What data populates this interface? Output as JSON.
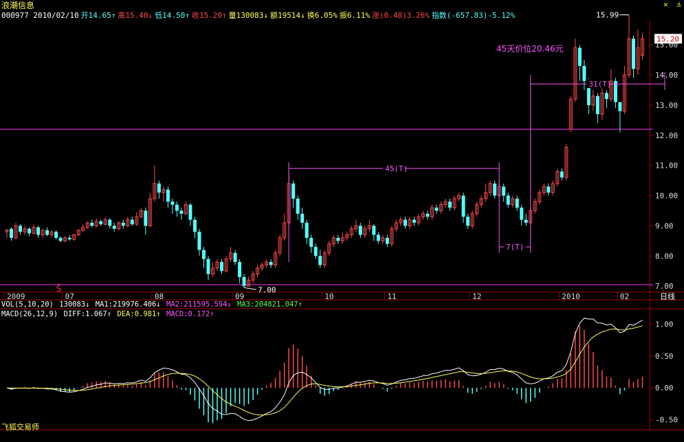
{
  "header": {
    "title": "浪潮信息",
    "quote": [
      {
        "text": "000977 2010/02/10",
        "color": "#ffffff"
      },
      {
        "text": "开14.65↑",
        "color": "#55ffff"
      },
      {
        "text": "高15.40↓",
        "color": "#ff4a4a"
      },
      {
        "text": "低14.50↑",
        "color": "#55ffff"
      },
      {
        "text": "收15.20↑",
        "color": "#ff4a4a"
      },
      {
        "text": "量130083↓",
        "color": "#ffff55"
      },
      {
        "text": "额19514↓",
        "color": "#ffff55"
      },
      {
        "text": "换6.05%",
        "color": "#ffff55"
      },
      {
        "text": "振6.11%",
        "color": "#ffff55"
      },
      {
        "text": "涨(0.48)3.26%",
        "color": "#ff4a4a"
      },
      {
        "text": "指数(-657.83)-5.12%",
        "color": "#55ffff"
      }
    ],
    "icons": [
      "close-icon",
      "anchor-icon"
    ]
  },
  "chart_data": {
    "type": "candlestick",
    "period_label": "日线",
    "ylim": [
      6.8,
      15.8
    ],
    "price_ticks": [
      "7.00",
      "8.00",
      "9.00",
      "10.00",
      "11.00",
      "12.00",
      "13.00",
      "14.00",
      "15.00"
    ],
    "current_price": "15.20",
    "x_labels": [
      {
        "text": "2009",
        "i": 0
      },
      {
        "text": "07",
        "i": 13
      },
      {
        "text": "08",
        "i": 33
      },
      {
        "text": "09",
        "i": 51
      },
      {
        "text": "10",
        "i": 71
      },
      {
        "text": "11",
        "i": 85
      },
      {
        "text": "12",
        "i": 104
      },
      {
        "text": "2010",
        "i": 124
      },
      {
        "text": "02",
        "i": 137
      }
    ],
    "candles": [
      [
        8.8,
        8.85,
        8.6,
        8.9
      ],
      [
        8.9,
        8.6,
        8.5,
        8.95
      ],
      [
        8.6,
        9.0,
        8.55,
        9.1
      ],
      [
        9.0,
        8.8,
        8.7,
        9.05
      ],
      [
        8.8,
        8.9,
        8.7,
        9.0
      ],
      [
        8.9,
        8.75,
        8.65,
        8.95
      ],
      [
        8.75,
        8.95,
        8.7,
        9.05
      ],
      [
        8.95,
        8.7,
        8.6,
        9.0
      ],
      [
        8.7,
        8.85,
        8.6,
        8.9
      ],
      [
        8.85,
        8.7,
        8.65,
        8.95
      ],
      [
        8.7,
        8.8,
        8.6,
        8.85
      ],
      [
        8.8,
        8.6,
        8.55,
        8.85
      ],
      [
        8.6,
        8.5,
        8.45,
        8.65
      ],
      [
        8.5,
        8.6,
        8.45,
        8.65
      ],
      [
        8.6,
        8.55,
        8.5,
        8.7
      ],
      [
        8.55,
        8.7,
        8.5,
        8.75
      ],
      [
        8.7,
        8.85,
        8.65,
        8.9
      ],
      [
        8.85,
        8.95,
        8.8,
        9.05
      ],
      [
        8.95,
        9.1,
        8.9,
        9.15
      ],
      [
        9.1,
        9.0,
        8.95,
        9.2
      ],
      [
        9.0,
        9.15,
        8.95,
        9.25
      ],
      [
        9.15,
        9.05,
        9.0,
        9.2
      ],
      [
        9.05,
        9.2,
        9.0,
        9.3
      ],
      [
        9.2,
        9.0,
        8.9,
        9.25
      ],
      [
        9.0,
        8.9,
        8.8,
        9.1
      ],
      [
        8.9,
        9.1,
        8.85,
        9.15
      ],
      [
        9.1,
        9.0,
        8.9,
        9.2
      ],
      [
        9.0,
        9.2,
        8.95,
        9.3
      ],
      [
        9.2,
        9.05,
        9.0,
        9.3
      ],
      [
        9.05,
        9.3,
        9.0,
        9.45
      ],
      [
        9.3,
        9.5,
        9.25,
        9.6
      ],
      [
        9.5,
        9.0,
        8.7,
        9.6
      ],
      [
        9.0,
        9.9,
        8.95,
        10.1
      ],
      [
        9.9,
        10.4,
        9.8,
        11.0
      ],
      [
        10.4,
        10.1,
        9.9,
        10.5
      ],
      [
        10.1,
        10.2,
        9.8,
        10.3
      ],
      [
        10.2,
        9.8,
        9.6,
        10.3
      ],
      [
        9.8,
        9.7,
        9.4,
        9.9
      ],
      [
        9.7,
        9.5,
        9.3,
        9.8
      ],
      [
        9.5,
        9.4,
        9.2,
        9.6
      ],
      [
        9.4,
        9.7,
        9.35,
        9.8
      ],
      [
        9.7,
        9.2,
        9.0,
        9.75
      ],
      [
        9.2,
        8.8,
        8.6,
        9.3
      ],
      [
        8.8,
        8.2,
        8.0,
        8.9
      ],
      [
        8.2,
        7.9,
        7.6,
        8.3
      ],
      [
        7.9,
        7.4,
        7.2,
        8.0
      ],
      [
        7.4,
        7.6,
        7.3,
        7.8
      ],
      [
        7.6,
        7.8,
        7.5,
        7.9
      ],
      [
        7.8,
        7.5,
        7.4,
        7.9
      ],
      [
        7.5,
        7.9,
        7.45,
        8.0
      ],
      [
        7.9,
        8.1,
        7.8,
        8.3
      ],
      [
        8.1,
        7.8,
        7.7,
        8.2
      ],
      [
        7.8,
        7.3,
        7.1,
        7.9
      ],
      [
        7.3,
        7.0,
        6.95,
        7.4
      ],
      [
        7.0,
        7.2,
        7.0,
        7.3
      ],
      [
        7.2,
        7.4,
        7.1,
        7.5
      ],
      [
        7.4,
        7.6,
        7.3,
        7.7
      ],
      [
        7.6,
        7.7,
        7.5,
        7.8
      ],
      [
        7.7,
        7.8,
        7.6,
        7.9
      ],
      [
        7.8,
        7.7,
        7.6,
        7.9
      ],
      [
        7.7,
        8.1,
        7.6,
        8.2
      ],
      [
        8.1,
        8.6,
        8.0,
        8.7
      ],
      [
        8.6,
        9.1,
        8.5,
        9.4
      ],
      [
        9.1,
        10.4,
        9.0,
        10.8
      ],
      [
        10.4,
        9.9,
        9.6,
        10.5
      ],
      [
        9.9,
        9.4,
        9.2,
        10.0
      ],
      [
        9.4,
        9.1,
        8.9,
        9.6
      ],
      [
        9.1,
        8.6,
        8.4,
        9.2
      ],
      [
        8.6,
        8.3,
        8.1,
        8.7
      ],
      [
        8.3,
        8.0,
        7.9,
        8.4
      ],
      [
        8.0,
        7.7,
        7.6,
        8.2
      ],
      [
        7.7,
        8.1,
        7.6,
        8.2
      ],
      [
        8.1,
        8.4,
        8.0,
        8.5
      ],
      [
        8.4,
        8.6,
        8.3,
        8.7
      ],
      [
        8.6,
        8.5,
        8.4,
        8.7
      ],
      [
        8.5,
        8.6,
        8.4,
        8.8
      ],
      [
        8.6,
        8.7,
        8.5,
        8.8
      ],
      [
        8.7,
        8.9,
        8.6,
        9.0
      ],
      [
        8.9,
        9.0,
        8.8,
        9.2
      ],
      [
        9.0,
        8.7,
        8.6,
        9.1
      ],
      [
        8.7,
        8.9,
        8.6,
        9.0
      ],
      [
        8.9,
        9.0,
        8.8,
        9.2
      ],
      [
        9.0,
        8.7,
        8.5,
        9.05
      ],
      [
        8.7,
        8.5,
        8.4,
        8.8
      ],
      [
        8.5,
        8.6,
        8.4,
        8.7
      ],
      [
        8.6,
        8.4,
        8.3,
        8.7
      ],
      [
        8.4,
        8.9,
        8.3,
        9.0
      ],
      [
        8.9,
        9.1,
        8.8,
        9.2
      ],
      [
        9.1,
        9.2,
        9.0,
        9.3
      ],
      [
        9.2,
        9.0,
        8.9,
        9.3
      ],
      [
        9.0,
        9.2,
        8.9,
        9.3
      ],
      [
        9.2,
        9.1,
        9.0,
        9.3
      ],
      [
        9.1,
        9.3,
        9.0,
        9.4
      ],
      [
        9.3,
        9.4,
        9.2,
        9.5
      ],
      [
        9.4,
        9.3,
        9.2,
        9.5
      ],
      [
        9.3,
        9.6,
        9.2,
        9.7
      ],
      [
        9.6,
        9.5,
        9.4,
        9.7
      ],
      [
        9.5,
        9.7,
        9.4,
        9.8
      ],
      [
        9.7,
        9.8,
        9.6,
        9.9
      ],
      [
        9.8,
        9.6,
        9.5,
        9.9
      ],
      [
        9.6,
        9.9,
        9.5,
        10.0
      ],
      [
        9.9,
        10.0,
        9.8,
        10.1
      ],
      [
        10.0,
        9.3,
        9.1,
        10.1
      ],
      [
        9.3,
        9.0,
        8.9,
        9.4
      ],
      [
        9.0,
        9.4,
        8.9,
        9.5
      ],
      [
        9.4,
        9.7,
        9.3,
        9.8
      ],
      [
        9.7,
        9.9,
        9.6,
        10.0
      ],
      [
        9.9,
        10.1,
        9.8,
        10.4
      ],
      [
        10.1,
        10.4,
        10.0,
        10.5
      ],
      [
        10.4,
        10.0,
        9.9,
        10.5
      ],
      [
        10.0,
        10.3,
        9.9,
        10.5
      ],
      [
        10.3,
        10.0,
        9.8,
        10.4
      ],
      [
        10.0,
        9.7,
        9.6,
        10.1
      ],
      [
        9.7,
        9.9,
        9.6,
        10.0
      ],
      [
        9.9,
        9.6,
        9.5,
        10.0
      ],
      [
        9.6,
        9.2,
        9.0,
        9.7
      ],
      [
        9.2,
        9.1,
        9.0,
        9.4
      ],
      [
        9.1,
        9.5,
        9.0,
        9.6
      ],
      [
        9.5,
        9.8,
        9.4,
        9.9
      ],
      [
        9.8,
        10.1,
        9.7,
        10.2
      ],
      [
        10.1,
        10.3,
        10.0,
        10.4
      ],
      [
        10.3,
        10.1,
        10.0,
        10.4
      ],
      [
        10.1,
        10.4,
        10.0,
        10.5
      ],
      [
        10.4,
        10.8,
        10.3,
        10.9
      ],
      [
        10.8,
        10.6,
        10.5,
        10.9
      ],
      [
        10.6,
        11.6,
        10.5,
        11.7
      ],
      [
        12.2,
        13.2,
        12.1,
        13.3
      ],
      [
        13.2,
        14.9,
        13.1,
        15.2
      ],
      [
        14.9,
        14.3,
        13.8,
        15.0
      ],
      [
        14.3,
        13.8,
        13.5,
        14.5
      ],
      [
        13.8,
        13.0,
        12.7,
        13.9
      ],
      [
        13.0,
        13.3,
        12.8,
        13.5
      ],
      [
        13.3,
        12.7,
        12.4,
        13.4
      ],
      [
        12.7,
        13.4,
        12.5,
        13.6
      ],
      [
        13.4,
        13.2,
        12.9,
        13.5
      ],
      [
        13.2,
        13.8,
        13.1,
        14.2
      ],
      [
        13.8,
        13.1,
        12.9,
        13.9
      ],
      [
        13.1,
        12.8,
        12.1,
        13.0
      ],
      [
        12.8,
        14.0,
        12.7,
        14.3
      ],
      [
        14.0,
        15.2,
        13.9,
        15.99
      ],
      [
        15.2,
        14.2,
        13.9,
        15.3
      ],
      [
        14.2,
        14.9,
        14.0,
        15.5
      ],
      [
        14.65,
        15.2,
        14.5,
        15.4
      ]
    ],
    "annotations": {
      "h_line_price": 12.2,
      "low_line_price": 7.05,
      "low_label": "7.00",
      "high_label": "15.99",
      "text_45day": "45天价位20.46元",
      "span_45": "45(T)",
      "span_31": "31(T)",
      "span_7": "7(T)",
      "buy_marker": "Ś"
    },
    "vol_ma": {
      "label": "VOL(5,10,20)",
      "vol": "130083↓",
      "ma1": "MA1:219976.406↓",
      "ma2": "MA2:211595.594↓",
      "ma3": "MA3:204821.047↑"
    },
    "macd": {
      "label": "MACD(26,12,9)",
      "diff": "DIFF:1.067↑",
      "dea": "DEA:0.981↑",
      "macd": "MACD:0.172↑",
      "ylim": [
        -0.6,
        1.1
      ],
      "ticks": [
        "1.00",
        "0.50",
        "0.00",
        "-0.50"
      ]
    }
  },
  "footer": {
    "brand": "飞狐交易师"
  },
  "colors": {
    "up": "#ff4a4a",
    "down": "#55ffff",
    "grid": "#ff33ff",
    "axis": "#aa0000",
    "magenta": "#ff55ff",
    "yellow": "#ffff55"
  }
}
